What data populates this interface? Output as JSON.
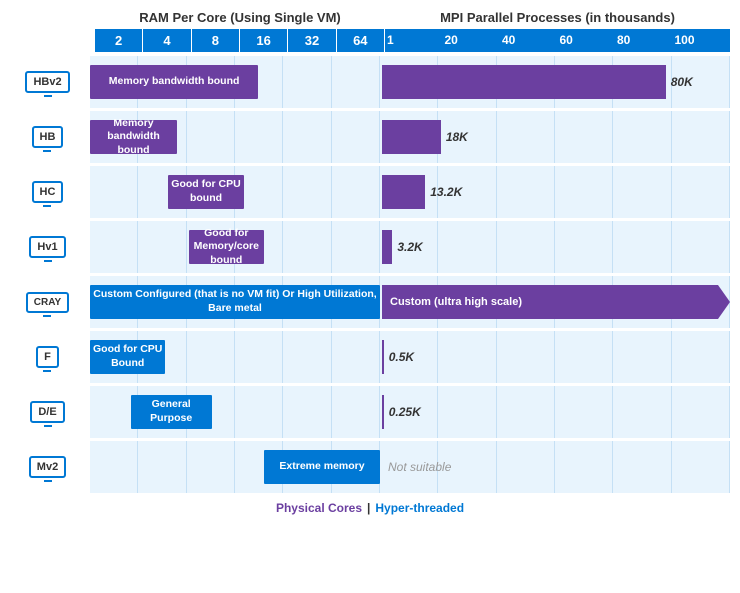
{
  "titles": {
    "left": "RAM Per Core (Using Single VM)",
    "right": "MPI Parallel Processes (in thousands)"
  },
  "ram_cols": [
    "2",
    "4",
    "8",
    "16",
    "32",
    "64"
  ],
  "mpi_ticks": [
    "1",
    "20",
    "40",
    "60",
    "80",
    "100"
  ],
  "rows": [
    {
      "label": "HBv2",
      "ram_bar": {
        "text": "Memory bandwidth bound",
        "left_pct": 0,
        "width_pct": 58,
        "color": "#6b3fa0"
      },
      "mpi": {
        "type": "bar_label",
        "width_pct": 82,
        "label": "80K",
        "color": "#6b3fa0"
      }
    },
    {
      "label": "HB",
      "ram_bar": {
        "text": "Memory\nbandwidth\nbound",
        "left_pct": 0,
        "width_pct": 30,
        "color": "#6b3fa0"
      },
      "mpi": {
        "type": "bar_label",
        "width_pct": 17,
        "label": "18K",
        "color": "#6b3fa0"
      }
    },
    {
      "label": "HC",
      "ram_bar": {
        "text": "Good for\nCPU bound",
        "left_pct": 27,
        "width_pct": 26,
        "color": "#6b3fa0"
      },
      "mpi": {
        "type": "bar_label",
        "width_pct": 12.5,
        "label": "13.2K",
        "color": "#6b3fa0"
      }
    },
    {
      "label": "Hv1",
      "ram_bar": {
        "text": "Good for\nMemory/core\nbound",
        "left_pct": 34,
        "width_pct": 26,
        "color": "#6b3fa0"
      },
      "mpi": {
        "type": "bar_label",
        "width_pct": 3,
        "label": "3.2K",
        "color": "#6b3fa0"
      }
    },
    {
      "label": "CRAY",
      "ram_bar": {
        "text": "Custom Configured  (that is no VM fit)\nOr High Utilization, Bare metal",
        "left_pct": 0,
        "width_pct": 100,
        "color": "#0078d4"
      },
      "mpi": {
        "type": "arrow_label",
        "label": "Custom (ultra high scale)",
        "color": "#6b3fa0"
      }
    },
    {
      "label": "F",
      "ram_bar": {
        "text": "Good for\nCPU Bound",
        "left_pct": 0,
        "width_pct": 26,
        "color": "#0078d4"
      },
      "mpi": {
        "type": "bar_label",
        "width_pct": 0.5,
        "label": "0.5K",
        "color": "#6b3fa0"
      }
    },
    {
      "label": "D/E",
      "ram_bar": {
        "text": "General\nPurpose",
        "left_pct": 14,
        "width_pct": 28,
        "color": "#0078d4"
      },
      "mpi": {
        "type": "bar_label",
        "width_pct": 0.25,
        "label": "0.25K",
        "color": "#6b3fa0"
      }
    },
    {
      "label": "Mv2",
      "ram_bar": {
        "text": "Extreme\nmemory",
        "left_pct": 60,
        "width_pct": 40,
        "color": "#0078d4"
      },
      "mpi": {
        "type": "not_suitable",
        "label": "Not suitable"
      }
    }
  ],
  "footer": {
    "physical": "Physical Cores",
    "divider": "|",
    "hyper": "Hyper-threaded"
  }
}
